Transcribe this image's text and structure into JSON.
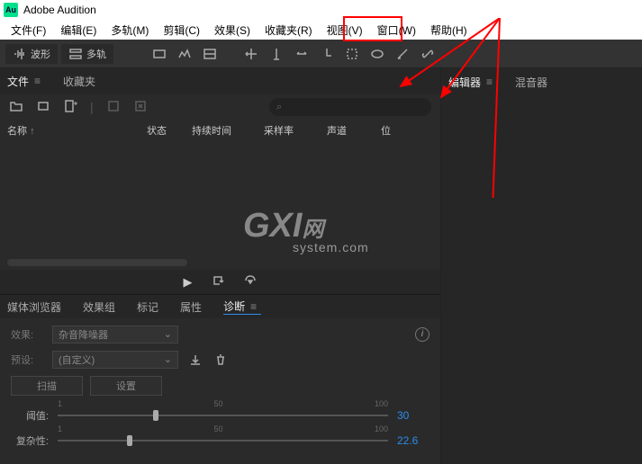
{
  "app": {
    "title": "Adobe Audition",
    "icon_text": "Au"
  },
  "menu": {
    "file": "文件(F)",
    "edit": "编辑(E)",
    "multitrack": "多轨(M)",
    "clip": "剪辑(C)",
    "effects": "效果(S)",
    "favorites": "收藏夹(R)",
    "view": "视图(V)",
    "window": "窗口(W)",
    "help": "帮助(H)"
  },
  "toolbar": {
    "waveform": "波形",
    "multitrack": "多轨"
  },
  "panels": {
    "files": "文件",
    "favorites": "收藏夹",
    "editor": "编辑器",
    "mixer": "混音器"
  },
  "columns": {
    "name": "名称",
    "status": "状态",
    "duration": "持续时间",
    "samplerate": "采样率",
    "channel": "声道",
    "bit": "位"
  },
  "search": {
    "icon": "⌕"
  },
  "lower_tabs": {
    "media_browser": "媒体浏览器",
    "effects_rack": "效果组",
    "markers": "标记",
    "properties": "属性",
    "diagnostics": "诊断"
  },
  "diag": {
    "effect_label": "效果:",
    "effect_value": "杂音降噪器",
    "preset_label": "预设:",
    "preset_value": "(自定义)",
    "scan": "扫描",
    "settings": "设置",
    "threshold": "阈值:",
    "complexity": "复杂性:",
    "tick_min": "1",
    "tick_mid": "50",
    "tick_max": "100",
    "val1": "30",
    "val2": "22.6"
  },
  "watermark": {
    "main": "GXI",
    "sub": "system.com",
    "net": "网"
  }
}
